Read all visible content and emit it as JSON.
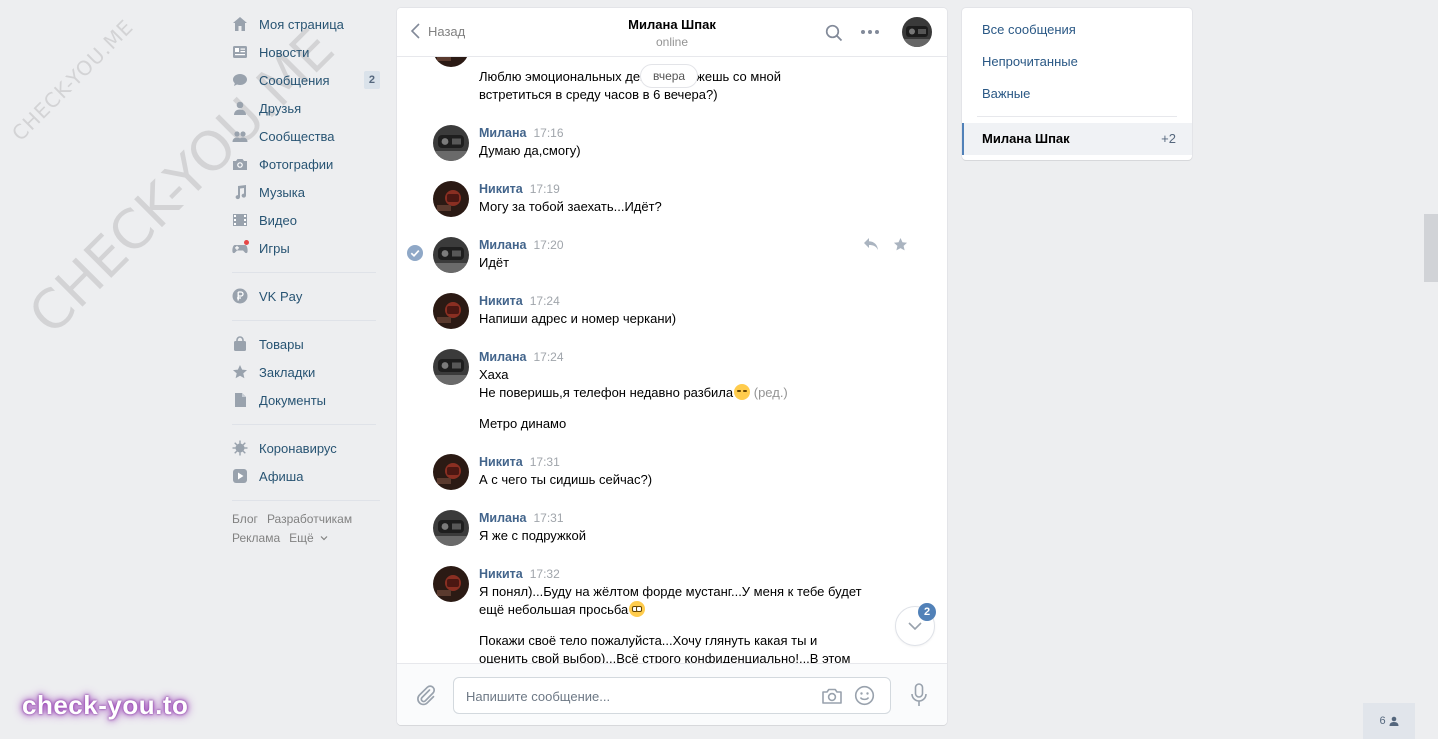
{
  "watermarks": {
    "small": "CHECK-YOU.ME",
    "big": "CHECK-YOU.ME",
    "logo": "check-you.to"
  },
  "leftnav": {
    "items": [
      {
        "label": "Моя страница",
        "icon": "home-icon"
      },
      {
        "label": "Новости",
        "icon": "news-icon"
      },
      {
        "label": "Сообщения",
        "icon": "messages-icon",
        "badge": "2"
      },
      {
        "label": "Друзья",
        "icon": "friends-icon"
      },
      {
        "label": "Сообщества",
        "icon": "groups-icon"
      },
      {
        "label": "Фотографии",
        "icon": "camera-icon"
      },
      {
        "label": "Музыка",
        "icon": "music-icon"
      },
      {
        "label": "Видео",
        "icon": "video-icon"
      },
      {
        "label": "Игры",
        "icon": "games-icon"
      }
    ],
    "pay": {
      "label": "VK Pay",
      "icon": "vkpay-icon"
    },
    "items2": [
      {
        "label": "Товары",
        "icon": "bag-icon"
      },
      {
        "label": "Закладки",
        "icon": "star-icon"
      },
      {
        "label": "Документы",
        "icon": "document-icon"
      }
    ],
    "items3": [
      {
        "label": "Коронавирус",
        "icon": "virus-icon"
      },
      {
        "label": "Афиша",
        "icon": "play-icon"
      }
    ],
    "footer": {
      "blog": "Блог",
      "dev": "Разработчикам",
      "ads": "Реклама",
      "more": "Ещё"
    }
  },
  "chat": {
    "back_label": "Назад",
    "peer_name": "Милана Шпак",
    "peer_status": "online",
    "date_pill": "вчера",
    "messages": [
      {
        "author": "",
        "time": "",
        "lines": [
          "Люблю эмоциональных девушек,можешь со мной",
          "встретиться в среду часов в 6 вечера?)"
        ]
      },
      {
        "author": "Милана",
        "time": "17:16",
        "lines": [
          "Думаю да,смогу)"
        ]
      },
      {
        "author": "Никита",
        "time": "17:19",
        "lines": [
          "Могу за тобой заехать...Идёт?"
        ]
      },
      {
        "author": "Милана",
        "time": "17:20",
        "lines": [
          "Идёт"
        ]
      },
      {
        "author": "Никита",
        "time": "17:24",
        "lines": [
          "Напиши адрес и номер черкани)"
        ]
      },
      {
        "author": "Милана",
        "time": "17:24",
        "line1": "Хаха",
        "line2": "Не поверишь,я телефон недавно разбила",
        "edited": "(ред.)",
        "line3": "Метро динамо"
      },
      {
        "author": "Никита",
        "time": "17:31",
        "lines": [
          "А с чего ты сидишь сейчас?)"
        ]
      },
      {
        "author": "Милана",
        "time": "17:31",
        "lines": [
          "Я же с подружкой"
        ]
      },
      {
        "author": "Никита",
        "time": "17:32",
        "line1": "Я понял)...Буду на жёлтом форде мустанг...У меня к тебе будет",
        "line2": "ещё небольшая просьба",
        "line3": "Покажи своё тело пожалуйста...Хочу глянуть какая ты и",
        "line4": "оценить свой выбор)...Всё строго конфиденциально!...В этом"
      }
    ],
    "unread_badge": "2",
    "composer_placeholder": "Напишите сообщение..."
  },
  "right_panel": {
    "all": "Все сообщения",
    "unread": "Непрочитанные",
    "important": "Важные",
    "active_name": "Милана Шпак",
    "active_count": "+2"
  },
  "friends_online": "6",
  "colors": {
    "link": "#2a5885",
    "author": "#42648b",
    "accent": "#5181b8",
    "bg": "#edeef0"
  }
}
